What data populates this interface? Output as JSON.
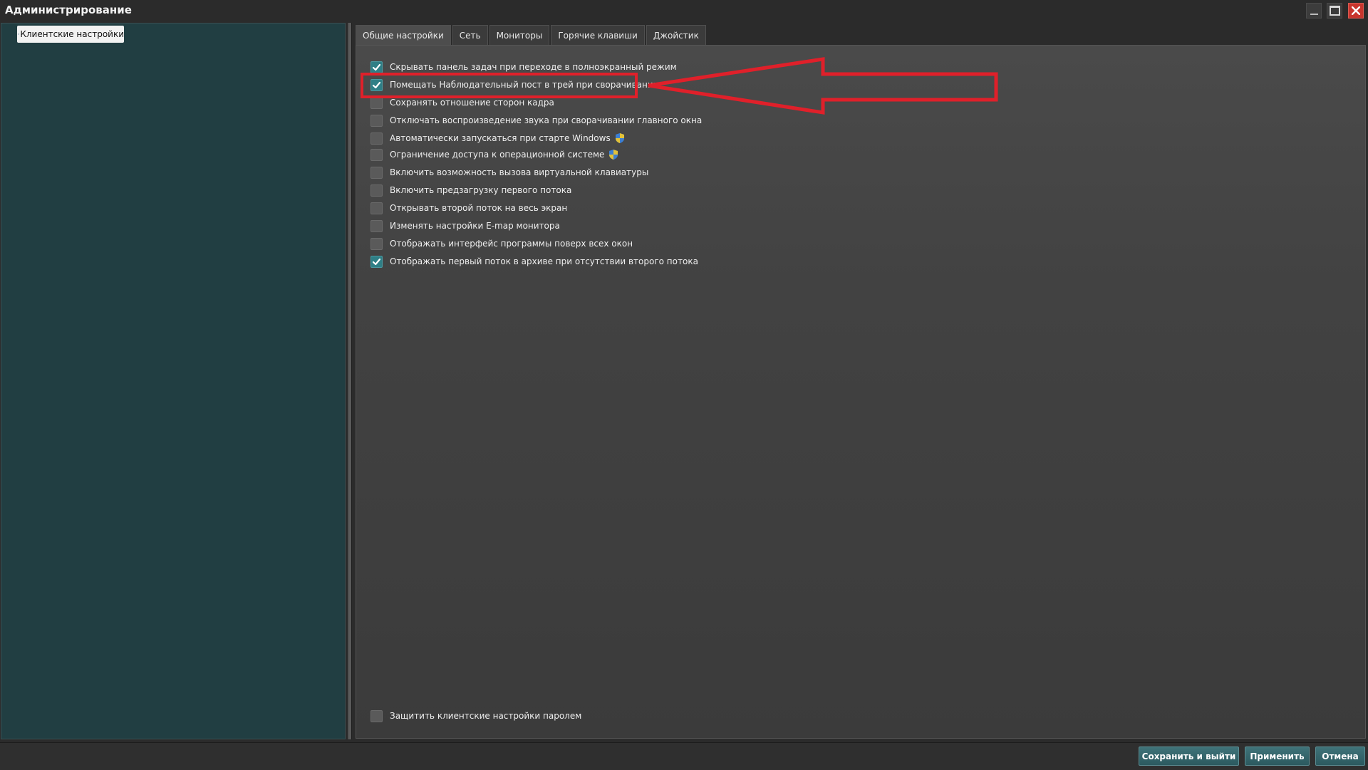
{
  "window": {
    "title": "Администрирование"
  },
  "tree": {
    "items": [
      {
        "label": "Клиентские настройки",
        "icon": "tools-icon",
        "selected": true
      }
    ]
  },
  "tabs": [
    {
      "label": "Общие настройки",
      "active": true
    },
    {
      "label": "Сеть",
      "active": false
    },
    {
      "label": "Мониторы",
      "active": false
    },
    {
      "label": "Горячие клавиши",
      "active": false
    },
    {
      "label": "Джойстик",
      "active": false
    }
  ],
  "options": [
    {
      "label": "Скрывать панель задач при переходе в полноэкранный режим",
      "checked": true,
      "shield": false
    },
    {
      "label": "Помещать Наблюдательный пост в трей при сворачивании",
      "checked": true,
      "shield": false
    },
    {
      "label": "Сохранять отношение сторон кадра",
      "checked": false,
      "shield": false
    },
    {
      "label": "Отключать воспроизведение звука при сворачивании главного окна",
      "checked": false,
      "shield": false
    },
    {
      "label": "Автоматически запускаться при старте Windows",
      "checked": false,
      "shield": true
    },
    {
      "label": "Ограничение доступа к операционной системе",
      "checked": false,
      "shield": true
    },
    {
      "label": "Включить возможность вызова виртуальной клавиатуры",
      "checked": false,
      "shield": false
    },
    {
      "label": "Включить предзагрузку первого потока",
      "checked": false,
      "shield": false
    },
    {
      "label": "Открывать второй поток на весь экран",
      "checked": false,
      "shield": false
    },
    {
      "label": "Изменять настройки E-map монитора",
      "checked": false,
      "shield": false
    },
    {
      "label": "Отображать интерфейс программы поверх всех окон",
      "checked": false,
      "shield": false
    },
    {
      "label": "Отображать первый поток в архиве при отсутствии второго потока",
      "checked": true,
      "shield": false
    }
  ],
  "password_option": {
    "label": "Защитить клиентские настройки паролем",
    "checked": false
  },
  "buttons": {
    "save_exit": "Сохранить и выйти",
    "apply": "Применить",
    "cancel": "Отмена"
  },
  "colors": {
    "accent": "#2f7f86",
    "left_panel": "#213e42",
    "annotation": "#e0202a",
    "close_button": "#c8352d"
  }
}
